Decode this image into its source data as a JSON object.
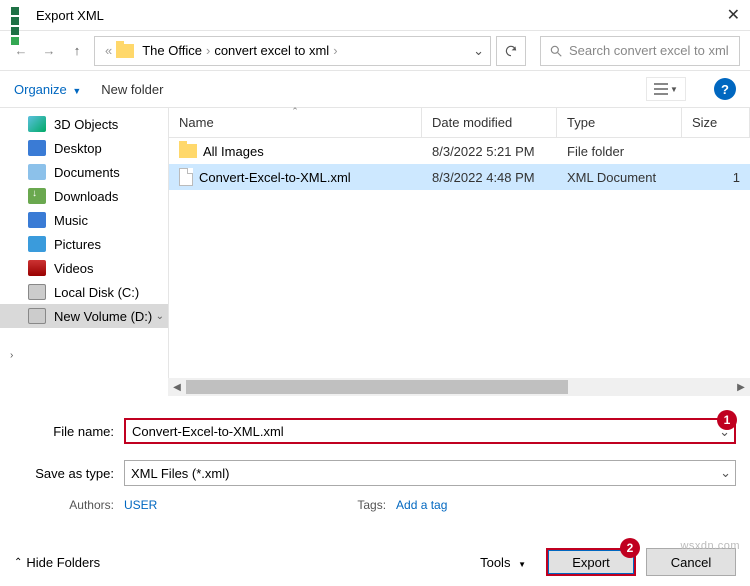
{
  "titlebar": {
    "title": "Export XML",
    "close": "✕"
  },
  "nav": {
    "back": "←",
    "fwd": "→",
    "up": "↑",
    "crumb1": "The Office",
    "crumb2": "convert excel to xml",
    "dropdown": "⌄",
    "refresh": "⟳",
    "search_placeholder": "Search convert excel to xml"
  },
  "toolbar": {
    "organize": "Organize",
    "newfolder": "New folder",
    "help": "?"
  },
  "sidebar": {
    "items": [
      {
        "label": "3D Objects"
      },
      {
        "label": "Desktop"
      },
      {
        "label": "Documents"
      },
      {
        "label": "Downloads"
      },
      {
        "label": "Music"
      },
      {
        "label": "Pictures"
      },
      {
        "label": "Videos"
      },
      {
        "label": "Local Disk (C:)"
      },
      {
        "label": "New Volume (D:)"
      }
    ]
  },
  "columns": {
    "name": "Name",
    "date": "Date modified",
    "type": "Type",
    "size": "Size"
  },
  "files": [
    {
      "name": "All Images",
      "date": "8/3/2022 5:21 PM",
      "type": "File folder",
      "size": ""
    },
    {
      "name": "Convert-Excel-to-XML.xml",
      "date": "8/3/2022 4:48 PM",
      "type": "XML Document",
      "size": "1"
    }
  ],
  "form": {
    "filename_label": "File name:",
    "filename_value": "Convert-Excel-to-XML.xml",
    "savetype_label": "Save as type:",
    "savetype_value": "XML Files (*.xml)",
    "authors_label": "Authors:",
    "authors_value": "USER",
    "tags_label": "Tags:",
    "tags_value": "Add a tag",
    "badge1": "1"
  },
  "footer": {
    "hide": "Hide Folders",
    "tools": "Tools",
    "export": "Export",
    "cancel": "Cancel",
    "badge2": "2"
  },
  "watermark": "wsxdn.com"
}
